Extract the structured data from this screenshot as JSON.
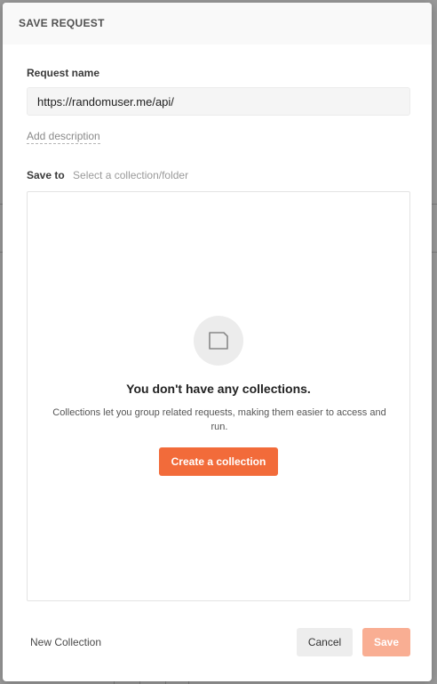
{
  "modal": {
    "title": "SAVE REQUEST"
  },
  "request_name": {
    "label": "Request name",
    "value": "https://randomuser.me/api/"
  },
  "add_description": "Add description",
  "save_to": {
    "label": "Save to",
    "hint": "Select a collection/folder"
  },
  "empty_state": {
    "icon": "folder-icon",
    "title": "You don't have any collections.",
    "description": "Collections let you group related requests, making them easier to access and run.",
    "create_label": "Create a collection"
  },
  "footer": {
    "new_collection_label": "New Collection",
    "cancel_label": "Cancel",
    "save_label": "Save"
  },
  "colors": {
    "accent": "#f26b3a",
    "save_disabled": "#f9ae93"
  }
}
